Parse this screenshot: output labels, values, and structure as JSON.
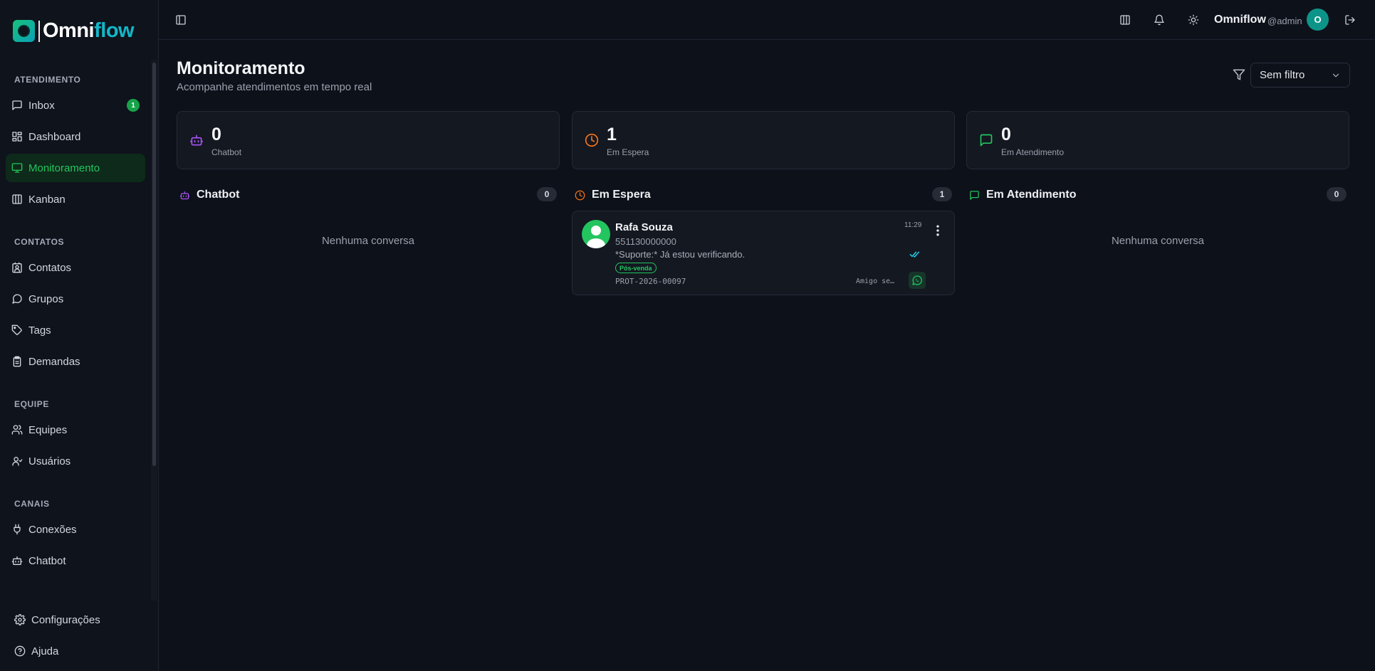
{
  "brand": {
    "prefix": "Omni",
    "suffix": "flow"
  },
  "sidebar": {
    "sections": [
      {
        "title": "ATENDIMENTO"
      },
      {
        "title": "CONTATOS"
      },
      {
        "title": "EQUIPE"
      },
      {
        "title": "CANAIS"
      }
    ],
    "items": [
      {
        "label": "Inbox",
        "icon": "message-square-icon",
        "badge": "1"
      },
      {
        "label": "Dashboard",
        "icon": "layout-dashboard-icon"
      },
      {
        "label": "Monitoramento",
        "icon": "monitor-icon",
        "active": true
      },
      {
        "label": "Kanban",
        "icon": "kanban-icon"
      },
      {
        "label": "Contatos",
        "icon": "contact-icon"
      },
      {
        "label": "Grupos",
        "icon": "message-circle-icon"
      },
      {
        "label": "Tags",
        "icon": "tag-icon"
      },
      {
        "label": "Demandas",
        "icon": "clipboard-icon"
      },
      {
        "label": "Equipes",
        "icon": "users-icon"
      },
      {
        "label": "Usuários",
        "icon": "user-icon"
      },
      {
        "label": "Conexões",
        "icon": "plug-icon"
      },
      {
        "label": "Chatbot",
        "icon": "bot-icon"
      }
    ],
    "footer": [
      {
        "label": "Configurações",
        "icon": "gear-icon"
      },
      {
        "label": "Ajuda",
        "icon": "help-circle-icon"
      }
    ]
  },
  "topbar": {
    "user_name": "Omniflow",
    "user_handle": "@admin",
    "avatar_initial": "O"
  },
  "page": {
    "title": "Monitoramento",
    "subtitle": "Acompanhe atendimentos em tempo real",
    "filter_value": "Sem filtro"
  },
  "stats": [
    {
      "value": "0",
      "label": "Chatbot",
      "color": "#a855f7"
    },
    {
      "value": "1",
      "label": "Em Espera",
      "color": "#f97316"
    },
    {
      "value": "0",
      "label": "Em Atendimento",
      "color": "#22c55e"
    }
  ],
  "columns": [
    {
      "title": "Chatbot",
      "count": "0",
      "empty_text": "Nenhuma conversa"
    },
    {
      "title": "Em Espera",
      "count": "1"
    },
    {
      "title": "Em Atendimento",
      "count": "0",
      "empty_text": "Nenhuma conversa"
    }
  ],
  "conversation": {
    "name": "Rafa Souza",
    "phone": "551130000000",
    "message": "*Suporte:* Já estou verificando.",
    "tag": "Pós-venda",
    "protocol": "PROT-2026-00097",
    "time": "11:29",
    "agent": "Amigo se…"
  },
  "colors": {
    "accent": "#22c55e",
    "background": "#0d111a",
    "card": "#141821"
  }
}
